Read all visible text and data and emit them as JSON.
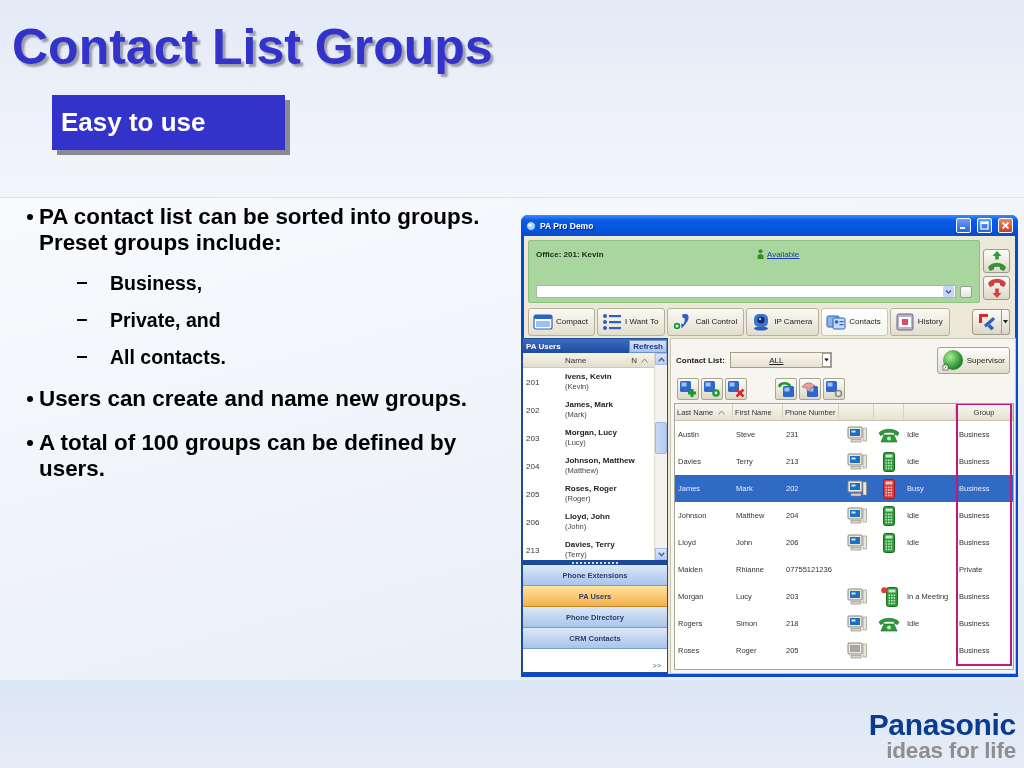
{
  "slide": {
    "title": "Contact List Groups",
    "subtitle": "Easy to use"
  },
  "bullets": [
    {
      "text": "PA contact list can be sorted into groups. Preset groups include:",
      "children": [
        {
          "text": "Business,"
        },
        {
          "text": "Private, and"
        },
        {
          "text": "All contacts."
        }
      ]
    },
    {
      "text": "Users can create and name new groups."
    },
    {
      "text": "A total of 100 groups can be defined by users."
    }
  ],
  "app_window": {
    "title": "PA Pro Demo",
    "status_panel": {
      "user": "Office: 201: Kevin",
      "presence": "Available"
    },
    "toolbar": [
      {
        "label": "Compact",
        "kind": "compact",
        "selected": false
      },
      {
        "label": "I Want To",
        "kind": "menu",
        "selected": false
      },
      {
        "label": "Call Control",
        "kind": "call",
        "selected": false
      },
      {
        "label": "IP Camera",
        "kind": "camera",
        "selected": false
      },
      {
        "label": "Contacts",
        "kind": "contacts",
        "selected": true
      },
      {
        "label": "History",
        "kind": "history",
        "selected": false
      }
    ],
    "users_panel": {
      "title": "PA Users",
      "refresh": "Refresh",
      "columns": [
        {
          "label": "Name",
          "sorted": false
        },
        {
          "label": "N",
          "sorted": true
        }
      ],
      "users": [
        {
          "ext": "201",
          "name": "Ivens, Kevin",
          "nickname": "(Kevin)"
        },
        {
          "ext": "202",
          "name": "James, Mark",
          "nickname": "(Mark)"
        },
        {
          "ext": "203",
          "name": "Morgan, Lucy",
          "nickname": "(Lucy)"
        },
        {
          "ext": "204",
          "name": "Johnson, Matthew",
          "nickname": "(Matthew)"
        },
        {
          "ext": "205",
          "name": "Roses, Roger",
          "nickname": "(Roger)"
        },
        {
          "ext": "206",
          "name": "Lloyd, John",
          "nickname": "(John)"
        },
        {
          "ext": "213",
          "name": "Davies, Terry",
          "nickname": "(Terry)"
        }
      ]
    },
    "nav": [
      {
        "label": "Phone Extensions",
        "selected": false
      },
      {
        "label": "PA Users",
        "selected": true
      },
      {
        "label": "Phone Directory",
        "selected": false
      },
      {
        "label": "CRM Contacts",
        "selected": false
      }
    ],
    "nav_more": ">>",
    "contacts": {
      "list_label": "Contact List:",
      "list_value": "ALL",
      "supervisor": "Supervisor",
      "columns": [
        {
          "label": "Last Name",
          "sorted": true,
          "highlighted": false
        },
        {
          "label": "First Name",
          "sorted": false,
          "highlighted": false
        },
        {
          "label": "Phone Number",
          "sorted": false,
          "highlighted": false
        },
        {
          "label": "Group",
          "sorted": false,
          "highlighted": true
        }
      ],
      "rows": [
        {
          "last": "Austin",
          "first": "Steve",
          "phone": "231",
          "pc": {
            "online": true
          },
          "device": {
            "kind": "desk",
            "busy": false,
            "badge": false
          },
          "status": "Idle",
          "group": "Business",
          "selected": false
        },
        {
          "last": "Davies",
          "first": "Terry",
          "phone": "213",
          "pc": {
            "online": true
          },
          "device": {
            "kind": "keypad",
            "busy": false,
            "badge": false
          },
          "status": "Idle",
          "group": "Business",
          "selected": false
        },
        {
          "last": "James",
          "first": "Mark",
          "phone": "202",
          "pc": {
            "online": true
          },
          "device": {
            "kind": "keypad",
            "busy": true,
            "badge": false
          },
          "status": "Busy",
          "group": "Business",
          "selected": true
        },
        {
          "last": "Johnson",
          "first": "Matthew",
          "phone": "204",
          "pc": {
            "online": true
          },
          "device": {
            "kind": "keypad",
            "busy": false,
            "badge": false
          },
          "status": "Idle",
          "group": "Business",
          "selected": false
        },
        {
          "last": "Lloyd",
          "first": "John",
          "phone": "206",
          "pc": {
            "online": true
          },
          "device": {
            "kind": "keypad",
            "busy": false,
            "badge": false
          },
          "status": "Idle",
          "group": "Business",
          "selected": false
        },
        {
          "last": "Maiden",
          "first": "Rhianne",
          "phone": "07755121236",
          "group": "Private",
          "selected": false
        },
        {
          "last": "Morgan",
          "first": "Lucy",
          "phone": "203",
          "pc": {
            "online": true
          },
          "device": {
            "kind": "keypad",
            "busy": false,
            "badge": true
          },
          "status": "In a Meeting",
          "group": "Business",
          "selected": false
        },
        {
          "last": "Rogers",
          "first": "Simon",
          "phone": "218",
          "pc": {
            "online": true
          },
          "device": {
            "kind": "desk",
            "busy": false,
            "badge": false
          },
          "status": "Idle",
          "group": "Business",
          "selected": false
        },
        {
          "last": "Roses",
          "first": "Roger",
          "phone": "205",
          "pc": {
            "online": false
          },
          "group": "Business",
          "selected": false
        }
      ]
    }
  },
  "logo": {
    "brand": "Panasonic",
    "tagline": "ideas for life"
  }
}
